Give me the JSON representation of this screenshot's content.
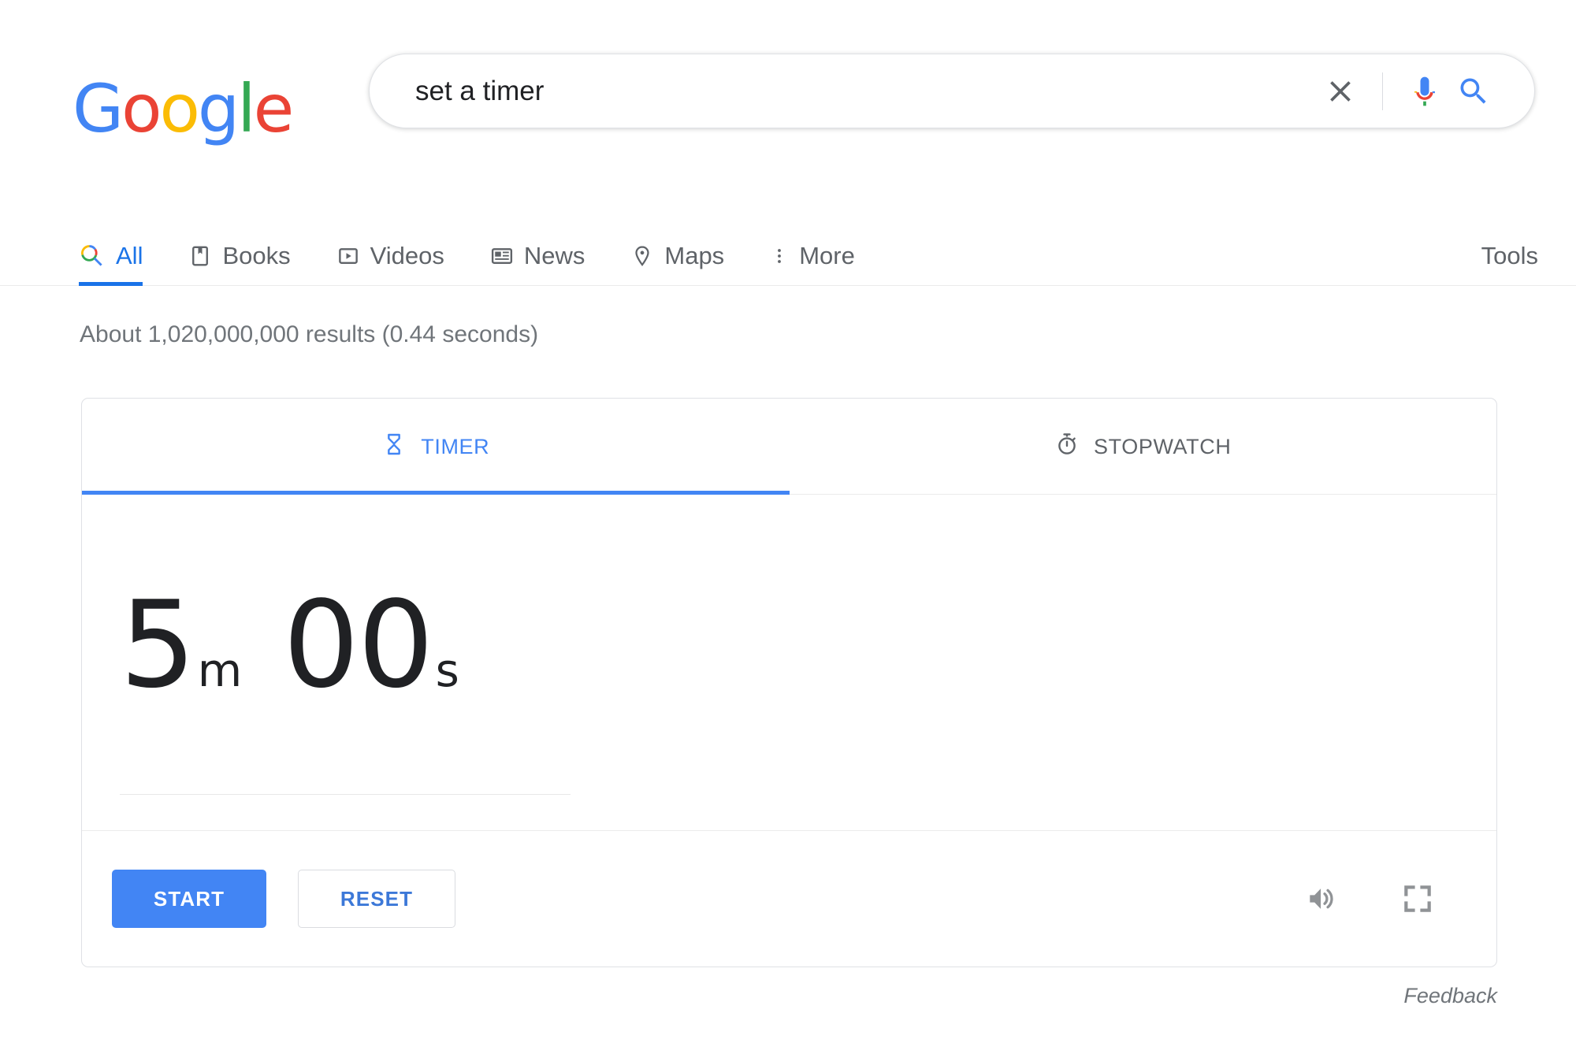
{
  "brand": {
    "logo_letters": [
      {
        "ch": "G",
        "color": "#4285F4"
      },
      {
        "ch": "o",
        "color": "#EA4335"
      },
      {
        "ch": "o",
        "color": "#FBBC05"
      },
      {
        "ch": "g",
        "color": "#4285F4"
      },
      {
        "ch": "l",
        "color": "#34A853"
      },
      {
        "ch": "e",
        "color": "#EA4335"
      }
    ],
    "logo_text": "Google"
  },
  "search": {
    "query": "set a timer",
    "placeholder": "Search",
    "clear_icon": "close-icon",
    "voice_icon": "microphone-icon",
    "submit_icon": "search-icon"
  },
  "nav": {
    "items": [
      {
        "label": "All",
        "icon": "search-icon",
        "active": true
      },
      {
        "label": "Books",
        "icon": "book-icon",
        "active": false
      },
      {
        "label": "Videos",
        "icon": "video-icon",
        "active": false
      },
      {
        "label": "News",
        "icon": "news-icon",
        "active": false
      },
      {
        "label": "Maps",
        "icon": "map-pin-icon",
        "active": false
      },
      {
        "label": "More",
        "icon": "more-vertical-icon",
        "active": false
      }
    ],
    "tools_label": "Tools"
  },
  "results": {
    "stats": "About 1,020,000,000 results (0.44 seconds)"
  },
  "timer_card": {
    "tabs": [
      {
        "label": "TIMER",
        "icon": "hourglass-icon",
        "active": true
      },
      {
        "label": "STOPWATCH",
        "icon": "stopwatch-icon",
        "active": false
      }
    ],
    "display": {
      "minutes": "5",
      "minutes_unit": "m",
      "seconds": "00",
      "seconds_unit": "s",
      "full": "5m 00s"
    },
    "actions": {
      "start_label": "START",
      "reset_label": "RESET"
    },
    "icons": {
      "sound": "volume-icon",
      "fullscreen": "fullscreen-icon"
    }
  },
  "feedback": {
    "label": "Feedback"
  },
  "colors": {
    "google_blue": "#4285f4",
    "link_blue": "#1a73e8",
    "google_red": "#EA4335",
    "google_yellow": "#FBBC05",
    "google_green": "#34A853",
    "text_gray": "#5f6368",
    "stats_gray": "#70757a",
    "border_gray": "#dfe1e5"
  }
}
